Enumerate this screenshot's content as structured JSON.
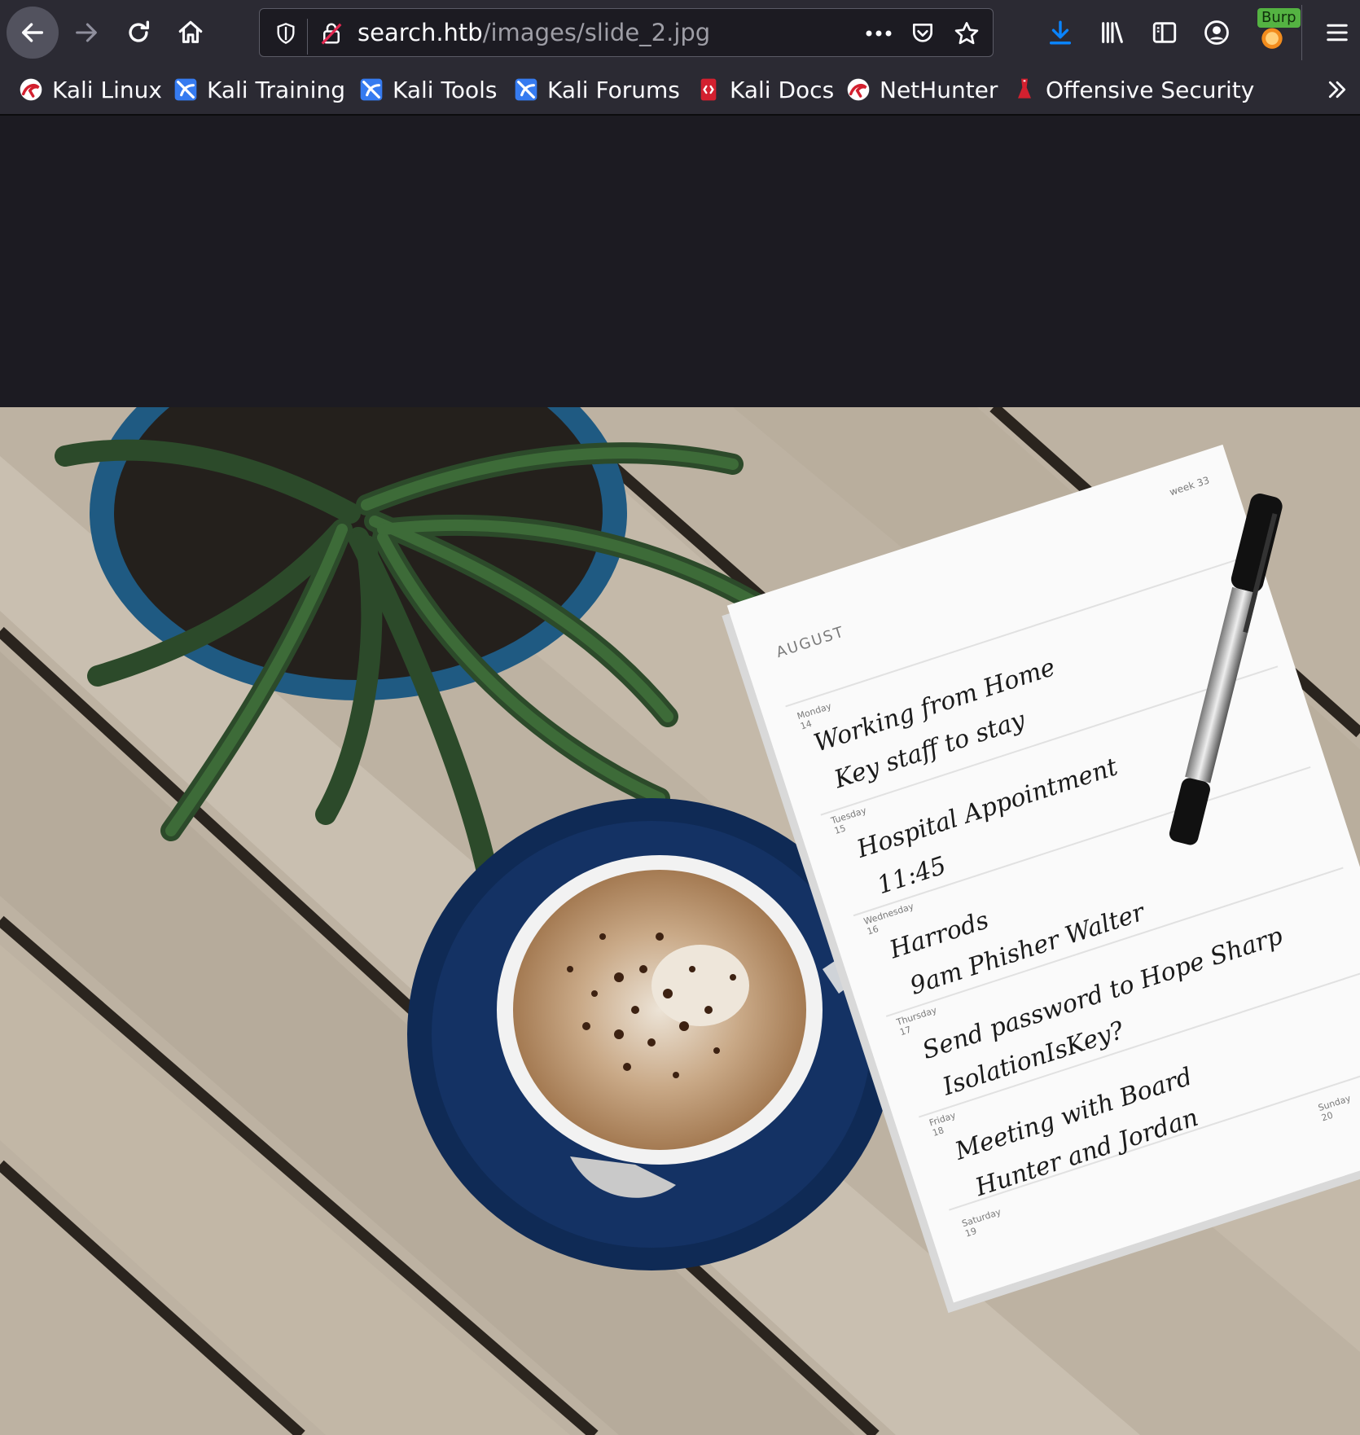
{
  "browser": {
    "url": {
      "host": "search.htb",
      "path": "/images/slide_2.jpg"
    },
    "burp_label": "Burp",
    "bookmarks": [
      {
        "label": "Kali Linux",
        "icon": "kali-dragon-icon"
      },
      {
        "label": "Kali Training",
        "icon": "kali-blue-icon"
      },
      {
        "label": "Kali Tools",
        "icon": "kali-blue-icon"
      },
      {
        "label": "Kali Forums",
        "icon": "kali-blue-icon"
      },
      {
        "label": "Kali Docs",
        "icon": "kali-docs-icon"
      },
      {
        "label": "NetHunter",
        "icon": "kali-dragon-icon"
      },
      {
        "label": "Offensive Security",
        "icon": "offsec-icon"
      }
    ]
  },
  "notebook": {
    "month": "AUGUST",
    "week": "week 33",
    "entries": {
      "day_monday": "Monday",
      "day_monday_num": "14",
      "line1": "Working from Home",
      "line2": "Key staff to stay",
      "day_tuesday": "Tuesday",
      "day_tuesday_num": "15",
      "line3": "Hospital Appointment",
      "line4": "11:45",
      "day_wednesday": "Wednesday",
      "day_wednesday_num": "16",
      "line5": "Harrods",
      "line6": "9am Phisher Walter",
      "day_thursday": "Thursday",
      "day_thursday_num": "17",
      "line7": "Send password to Hope Sharp",
      "line8": "IsolationIsKey?",
      "day_friday": "Friday",
      "day_friday_num": "18",
      "line9": "Meeting with Board",
      "line10": "Hunter and Jordan",
      "day_saturday": "Saturday",
      "day_saturday_num": "19",
      "day_sunday": "Sunday",
      "day_sunday_num": "20"
    }
  },
  "colors": {
    "toolbar": "#2b2a33",
    "page_bg": "#1c1b22",
    "download_accent": "#0a84ff"
  }
}
